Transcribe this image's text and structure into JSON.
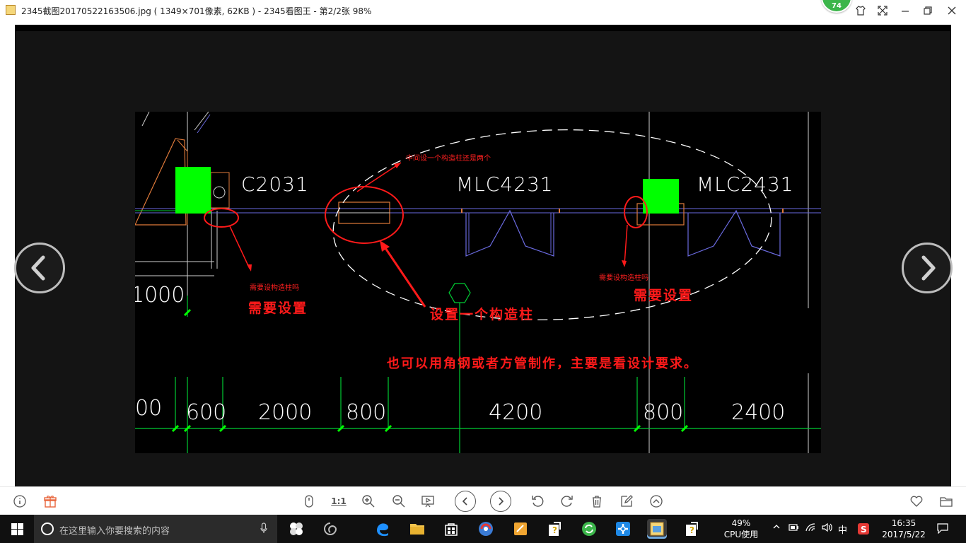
{
  "window": {
    "title": "2345截图20170522163506.jpg ( 1349×701像素, 62KB ) - 2345看图王 - 第2/2张 98%",
    "badge": "74"
  },
  "cad": {
    "labels": {
      "c2031": "C2031",
      "mlc4231": "MLC4231",
      "mlc2431": "MLC2431",
      "dim_1000": "1000"
    },
    "dimensions": [
      "00",
      "600",
      "2000",
      "800",
      "4200",
      "800",
      "2400"
    ],
    "notes": {
      "small_middle": "中间设一个构造柱还是两个",
      "small_left": "需要设构造柱吗",
      "small_right": "需要设构造柱吗",
      "need_left": "需要设置",
      "need_right": "需要设置",
      "one_column": "设置一个构造柱",
      "alt_material": "也可以用角钢或者方管制作，主要是看设计要求。"
    },
    "colors": {
      "green_column": "#00ff00",
      "red_annotation": "#ff1a1a",
      "wall_blue": "#6a6adf"
    }
  },
  "toolbar": {
    "icons": [
      "info-icon",
      "gift-icon",
      "scroll-icon",
      "actual-size-icon",
      "zoom-in-icon",
      "zoom-out-icon",
      "slideshow-icon",
      "prev-icon",
      "next-icon",
      "rotate-left-icon",
      "rotate-right-icon",
      "delete-icon",
      "edit-icon",
      "up-icon",
      "heart-icon",
      "folder-icon"
    ],
    "actual_size_label": "1:1"
  },
  "taskbar": {
    "search_placeholder": "在这里输入你要搜索的内容",
    "cpu_percent": "49%",
    "cpu_label": "CPU使用",
    "ime": "中",
    "time": "16:35",
    "date": "2017/5/22"
  }
}
